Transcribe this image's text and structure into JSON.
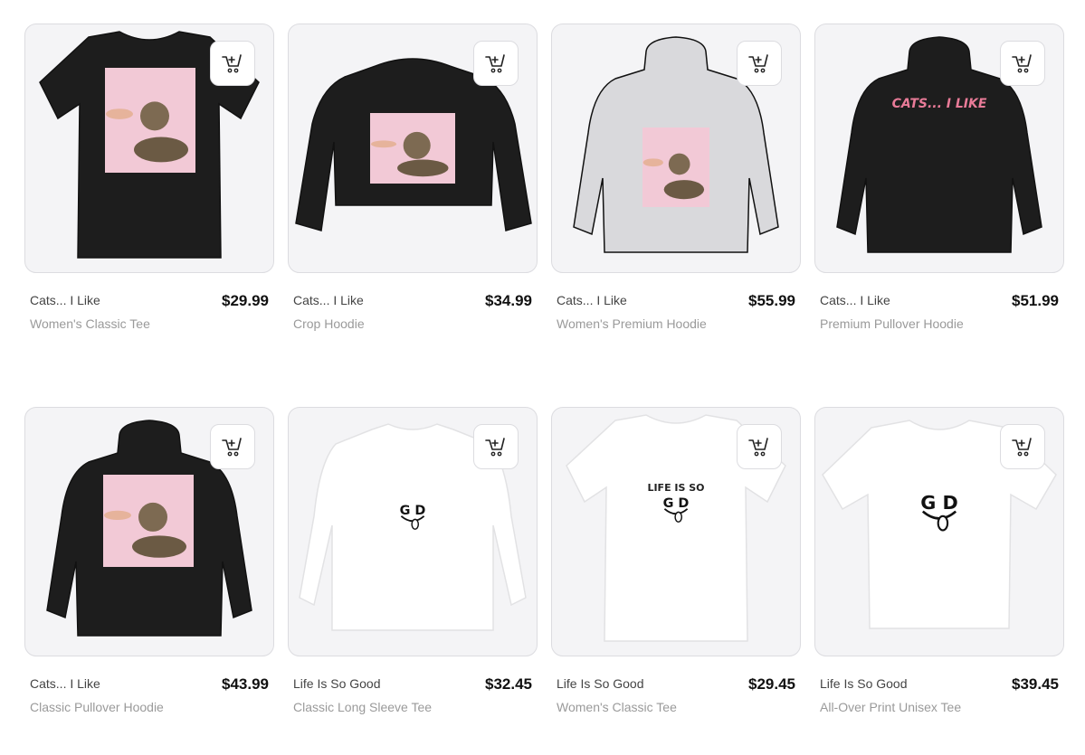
{
  "products": [
    {
      "name": "Cats... I Like",
      "type": "Women's Classic Tee",
      "price": "$29.99",
      "garment": "tee",
      "color": "#1d1d1d",
      "print": "cat",
      "print_text": ""
    },
    {
      "name": "Cats... I Like",
      "type": "Crop Hoodie",
      "price": "$34.99",
      "garment": "crop",
      "color": "#1d1d1d",
      "print": "cat",
      "print_text": ""
    },
    {
      "name": "Cats... I Like",
      "type": "Women's Premium Hoodie",
      "price": "$55.99",
      "garment": "hoodie",
      "color": "#d9d9dc",
      "print": "cat",
      "print_text": ""
    },
    {
      "name": "Cats... I Like",
      "type": "Premium Pullover Hoodie",
      "price": "$51.99",
      "garment": "hoodie-front",
      "color": "#1d1d1d",
      "print": "text",
      "print_text": "CATS... I LIKE"
    },
    {
      "name": "Cats... I Like",
      "type": "Classic Pullover Hoodie",
      "price": "$43.99",
      "garment": "hoodie",
      "color": "#1d1d1d",
      "print": "cat",
      "print_text": ""
    },
    {
      "name": "Life Is So Good",
      "type": "Classic Long Sleeve Tee",
      "price": "$32.45",
      "garment": "longsleeve",
      "color": "#ffffff",
      "print": "good",
      "print_text": "G  D"
    },
    {
      "name": "Life Is So Good",
      "type": "Women's Classic Tee",
      "price": "$29.45",
      "garment": "tee",
      "color": "#ffffff",
      "print": "good",
      "print_text": "LIFE IS SO"
    },
    {
      "name": "Life Is So Good",
      "type": "All-Over Print Unisex Tee",
      "price": "$39.45",
      "garment": "tee-wide",
      "color": "#ffffff",
      "print": "good",
      "print_text": "G  D"
    }
  ],
  "icons": {
    "cart": "cart-add-icon"
  },
  "colors": {
    "card_bg": "#f4f4f6",
    "border": "#dcdce0",
    "price": "#111111",
    "type": "#9a9a9a"
  }
}
